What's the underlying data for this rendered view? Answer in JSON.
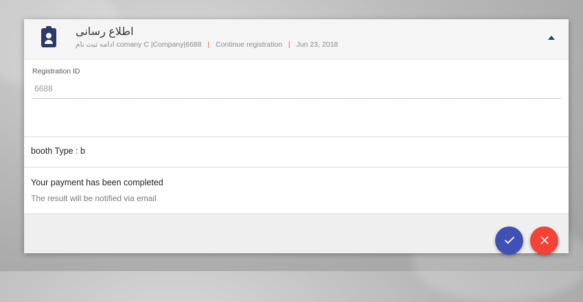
{
  "header": {
    "title": "اطلاع رسانی",
    "subtitle_rtl": "ادامه ثبت نام",
    "company": "comany C |Company|6688",
    "separator": "|",
    "status": "Continue registration",
    "date": "Jun 23, 2018"
  },
  "form": {
    "registration_label": "Registration ID",
    "registration_value": "6688"
  },
  "booth": {
    "text": "booth Type : b"
  },
  "payment": {
    "message": "Your payment has been completed",
    "note": "The result will be notified via email"
  },
  "actions": {
    "confirm_icon": "check-icon",
    "cancel_icon": "close-icon",
    "confirm_color": "#3f51b5",
    "cancel_color": "#f44336"
  },
  "colors": {
    "accent": "#2b3a6b",
    "separator": "#e05a4e"
  }
}
